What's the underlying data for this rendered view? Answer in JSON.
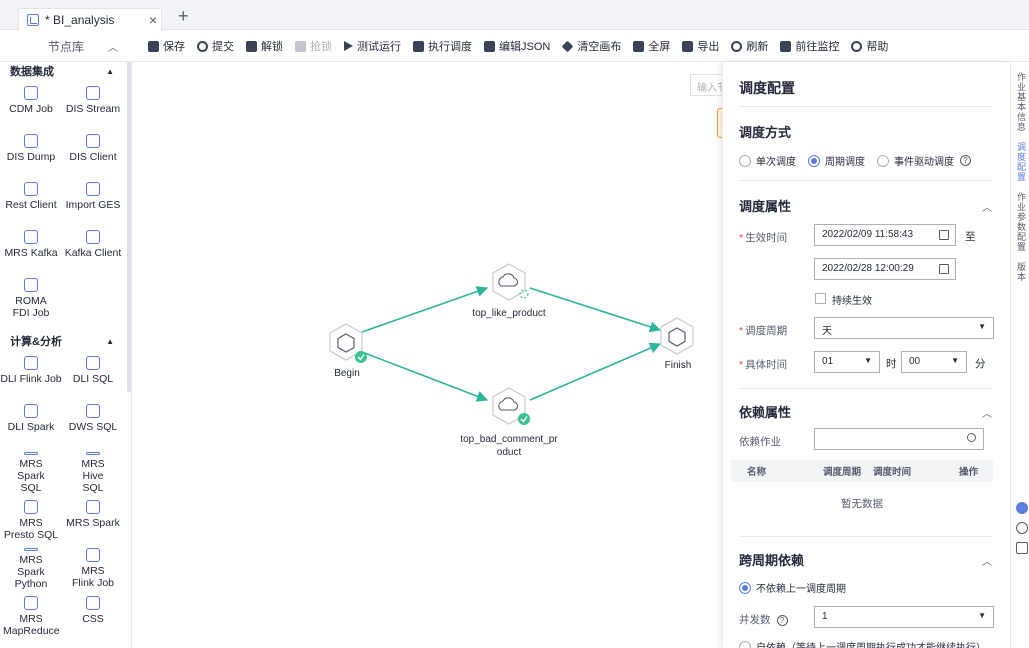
{
  "tab": {
    "title": "* BI_analysis",
    "close": "×",
    "add": "+"
  },
  "toolbar": {
    "library_title": "节点库",
    "items": [
      {
        "label": "保存",
        "icon": "save-icon"
      },
      {
        "label": "提交",
        "icon": "upload-icon"
      },
      {
        "label": "解锁",
        "icon": "unlock-icon"
      },
      {
        "label": "抢锁",
        "icon": "lock-icon",
        "disabled": true
      },
      {
        "label": "测试运行",
        "icon": "play-icon"
      },
      {
        "label": "执行调度",
        "icon": "schedule-icon"
      },
      {
        "label": "编辑JSON",
        "icon": "json-icon"
      },
      {
        "label": "清空画布",
        "icon": "eraser-icon"
      },
      {
        "label": "全屏",
        "icon": "fullscreen-icon"
      },
      {
        "label": "导出",
        "icon": "export-icon"
      },
      {
        "label": "刷新",
        "icon": "refresh-icon"
      },
      {
        "label": "前往监控",
        "icon": "monitor-icon"
      },
      {
        "label": "帮助",
        "icon": "help-icon"
      }
    ]
  },
  "library": {
    "groups": [
      {
        "title": "数据集成",
        "nodes": [
          "CDM Job",
          "DIS Stream",
          "DIS Dump",
          "DIS Client",
          "Rest Client",
          "Import GES",
          "MRS Kafka",
          "Kafka Client",
          "ROMA FDI Job"
        ]
      },
      {
        "title": "计算&分析",
        "nodes": [
          "DLI Flink Job",
          "DLI SQL",
          "DLI Spark",
          "DWS SQL",
          "MRS Spark SQL",
          "MRS Hive SQL",
          "MRS Presto SQL",
          "MRS Spark",
          "MRS Spark Python",
          "MRS Flink Job",
          "MRS MapReduce",
          "CSS"
        ]
      }
    ]
  },
  "canvas": {
    "search_placeholder": "输入节",
    "nodes": {
      "begin": "Begin",
      "like": "top_like_product",
      "bad1": "top_bad_comment_pr",
      "bad2": "oduct",
      "finish": "Finish"
    }
  },
  "panel": {
    "title": "调度配置",
    "mode_title": "调度方式",
    "mode_options": [
      "单次调度",
      "周期调度",
      "事件驱动调度"
    ],
    "mode_selected": "周期调度",
    "props_title": "调度属性",
    "effective_label": "生效时间",
    "start_time": "2022/02/09 11:58:43",
    "to": "至",
    "end_time": "2022/02/28 12:00:29",
    "persist_label": "持续生效",
    "period_label": "调度周期",
    "period_value": "天",
    "time_label": "具体时间",
    "hour_value": "01",
    "hour_unit": "时",
    "minute_value": "00",
    "minute_unit": "分",
    "dep_title": "依赖属性",
    "dep_job_label": "依赖作业",
    "table_headers": [
      "名称",
      "调度周期",
      "调度时间",
      "操作"
    ],
    "empty_text": "暂无数据",
    "cross_title": "跨周期依赖",
    "no_dep_option": "不依赖上一调度周期",
    "concurrency_label": "并发数",
    "concurrency_value": "1",
    "self_dep_option": "自依赖（等待上一调度周期执行成功才能继续执行）"
  },
  "strip": {
    "text1": "作业基本信息",
    "text2": "调度配置",
    "text3": "作业参数配置",
    "text4": "版本"
  },
  "colors": {
    "accent": "#5e7ce0",
    "success": "#3ac295",
    "edge": "#2bb59a"
  }
}
